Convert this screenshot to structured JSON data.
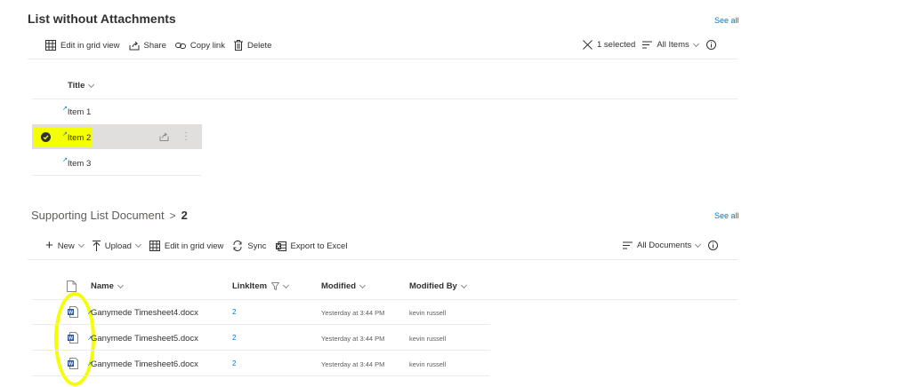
{
  "section1": {
    "title": "List without Attachments",
    "see_all": "See all",
    "toolbar": {
      "edit_grid": "Edit in grid view",
      "share": "Share",
      "copy_link": "Copy link",
      "delete": "Delete",
      "selected": "1 selected",
      "view": "All Items"
    },
    "column_title": "Title",
    "items": [
      {
        "label": "Item 1",
        "selected": false
      },
      {
        "label": "Item 2",
        "selected": true
      },
      {
        "label": "Item 3",
        "selected": false
      }
    ]
  },
  "section2": {
    "breadcrumb_parent": "Supporting List Document",
    "breadcrumb_current": "2",
    "see_all": "See all",
    "toolbar": {
      "new": "New",
      "upload": "Upload",
      "edit_grid": "Edit in grid view",
      "sync": "Sync",
      "export": "Export to Excel",
      "view": "All Documents"
    },
    "columns": {
      "name": "Name",
      "linkitem": "LinkItem",
      "modified": "Modified",
      "modified_by": "Modified By"
    },
    "rows": [
      {
        "name": "Ganymede Timesheet4.docx",
        "linkitem": "2",
        "modified": "Yesterday at 3:44 PM",
        "modified_by": "kevin russell"
      },
      {
        "name": "Ganymede Timesheet5.docx",
        "linkitem": "2",
        "modified": "Yesterday at 3:44 PM",
        "modified_by": "kevin russell"
      },
      {
        "name": "Ganymede Timesheet6.docx",
        "linkitem": "2",
        "modified": "Yesterday at 3:44 PM",
        "modified_by": "kevin russell"
      }
    ]
  },
  "colors": {
    "accent": "#0078d4",
    "highlight": "#f4ff00",
    "selected_row": "#e1dfdd",
    "word_icon": "#2b579a"
  }
}
